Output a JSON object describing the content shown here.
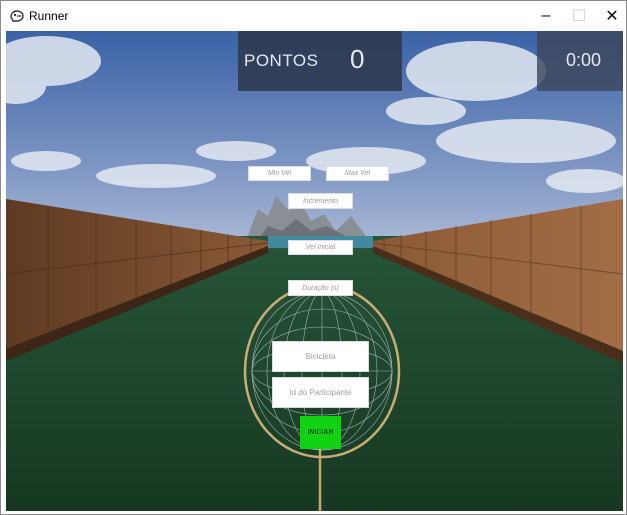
{
  "window": {
    "title": "Runner",
    "icon": "runner-app-icon",
    "minimize_glyph": "–",
    "maximize_glyph": "☐",
    "close_glyph": "✕"
  },
  "hud": {
    "score_label": "PONTOS",
    "score_value": "0",
    "timer_value": "0:00"
  },
  "fields": {
    "min_vel_placeholder": "Min Vel",
    "max_vel_placeholder": "Max Vel",
    "increment_placeholder": "Incremento",
    "initial_vel_placeholder": "Vel Inicial",
    "duration_placeholder": "Duração (s)",
    "device_placeholder": "Bicicleta",
    "participant_id_placeholder": "Id do Participante"
  },
  "start_button": {
    "label": "INICIAR",
    "color": "#12d312"
  },
  "colors": {
    "sky_top": "#3f67a8",
    "sky_bottom": "#aab9d6",
    "grass": "#1f4a2b",
    "wall": "#7a4a2c",
    "hud_bg": "#2d374b"
  }
}
